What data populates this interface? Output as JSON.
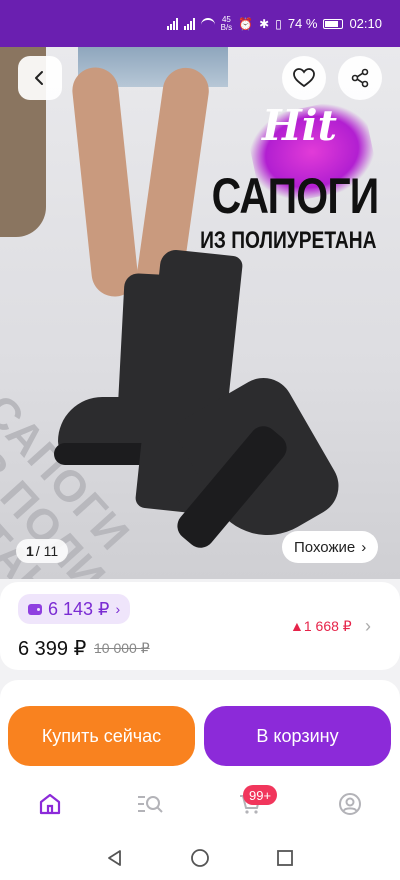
{
  "status_bar": {
    "net_speed_value": "45",
    "net_speed_unit": "B/s",
    "battery_percent": "74 %",
    "time": "02:10"
  },
  "product": {
    "badge_text": "Hit",
    "title": "САПОГИ",
    "subtitle": "ИЗ ПОЛИУРЕТАНА",
    "floor_text": "САПОГИ\nИЗ ПОЛИ\nУРЕТАНА",
    "image_counter_current": "1",
    "image_counter_total": "/ 11",
    "similar_label": "Похожие",
    "similar_chevron": "›"
  },
  "price": {
    "wallet_price": "6 143 ₽",
    "wallet_chevron": "›",
    "price": "6 399 ₽",
    "old_price": "10 000 ₽",
    "price_drop": "▲1 668 ₽",
    "drop_chevron": "›"
  },
  "actions": {
    "buy_now": "Купить сейчас",
    "add_to_cart": "В корзину"
  },
  "bottom_nav": {
    "cart_badge": "99+",
    "items": [
      "home-icon",
      "catalog-search-icon",
      "cart-icon",
      "profile-icon"
    ]
  },
  "colors": {
    "status_bar": "#6a1fb0",
    "accent_purple": "#8c2ad9",
    "accent_orange": "#f9821f",
    "price_drop_red": "#e6244a",
    "badge_red": "#f1365c"
  }
}
